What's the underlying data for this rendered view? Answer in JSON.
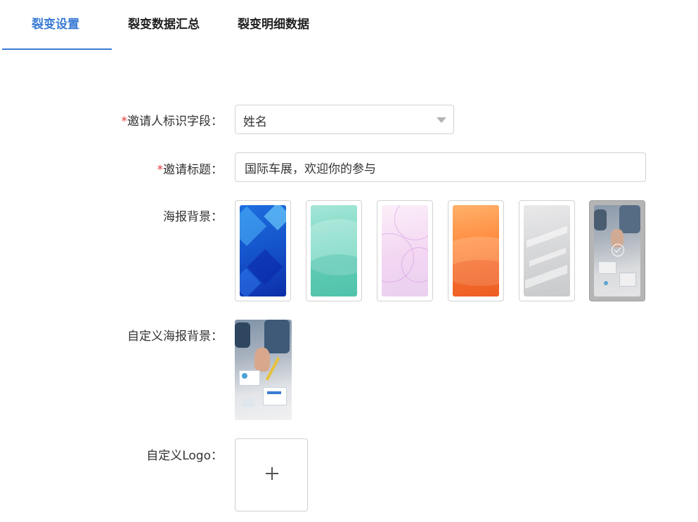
{
  "tabs": [
    {
      "label": "裂变设置",
      "active": true
    },
    {
      "label": "裂变数据汇总",
      "active": false
    },
    {
      "label": "裂变明细数据",
      "active": false
    }
  ],
  "form": {
    "required_mark": "*",
    "inviter_field": {
      "label": "邀请人标识字段：",
      "value": "姓名"
    },
    "invite_title": {
      "label": "邀请标题：",
      "value": "国际车展，欢迎你的参与"
    },
    "poster_background": {
      "label": "海报背景：",
      "options": [
        "blue-geometric",
        "teal-waves",
        "pink-rings",
        "orange-waves",
        "gray-abstract",
        "business-photo"
      ],
      "selected": "business-photo"
    },
    "custom_poster_background": {
      "label": "自定义海报背景："
    },
    "custom_logo": {
      "label": "自定义Logo："
    }
  },
  "colors": {
    "accent": "#3a7bd5",
    "required": "#e0393e"
  }
}
